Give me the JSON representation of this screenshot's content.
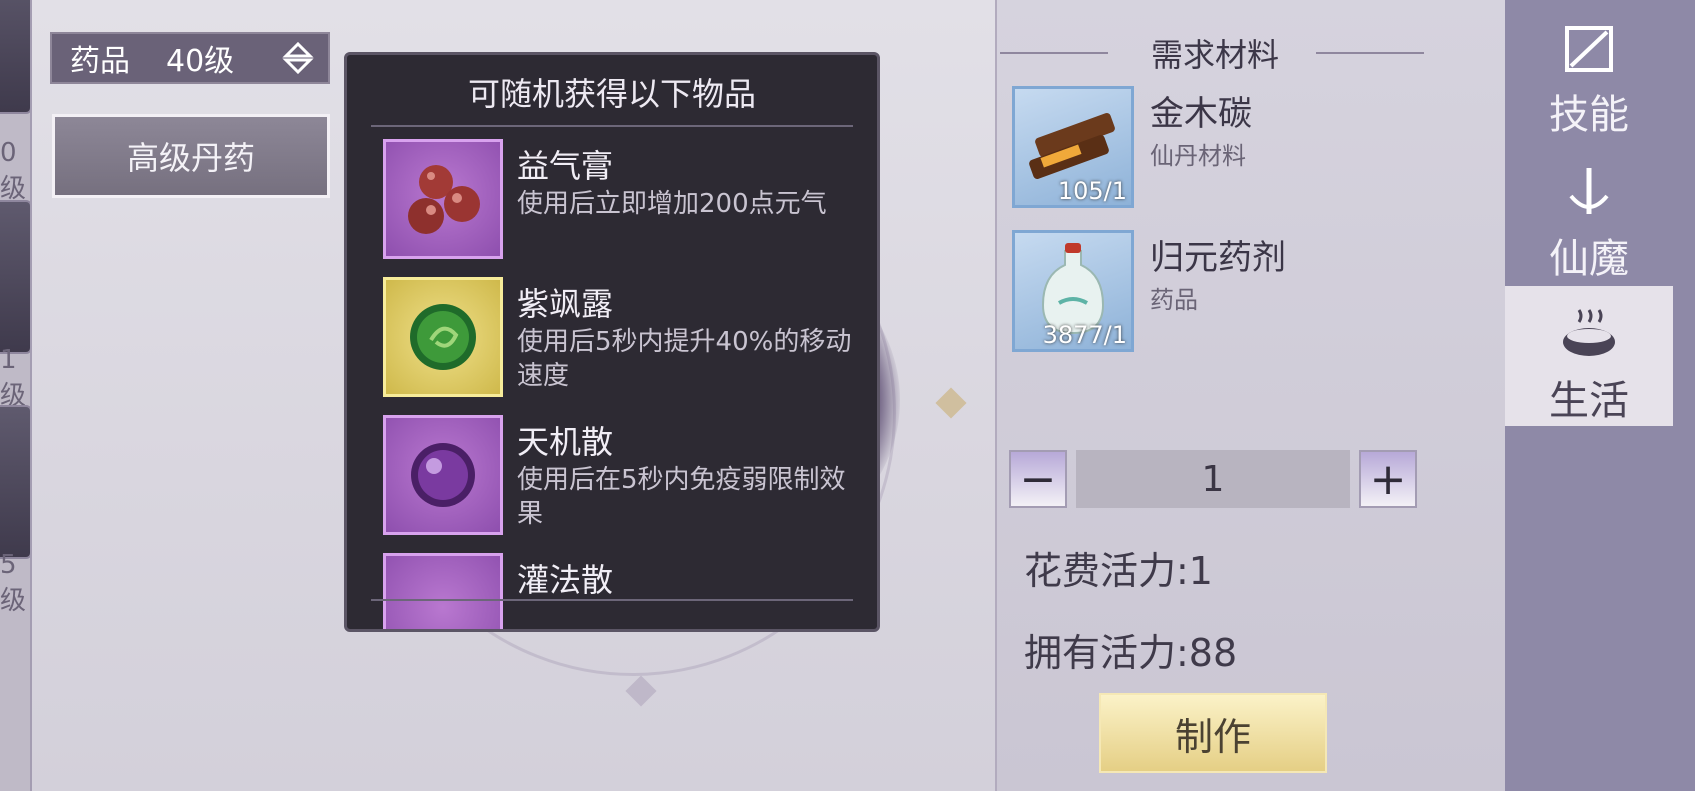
{
  "left_strip": {
    "partial_labels": [
      "0级",
      "1级",
      "5级"
    ]
  },
  "filter": {
    "category": "药品",
    "level": "40级"
  },
  "subtab": {
    "label": "高级丹药"
  },
  "popup": {
    "title": "可随机获得以下物品",
    "items": [
      {
        "name": "益气膏",
        "desc": "使用后立即增加200点元气",
        "icon": "red-pills-icon"
      },
      {
        "name": "紫飒露",
        "desc": "使用后5秒内提升40%的移动速度",
        "icon": "green-orb-icon"
      },
      {
        "name": "天机散",
        "desc": "使用后在5秒内免疫弱限制效果",
        "icon": "purple-orb-icon"
      },
      {
        "name": "灌法散",
        "desc": "",
        "icon": "item-icon"
      }
    ]
  },
  "materials": {
    "title": "需求材料",
    "list": [
      {
        "name": "金木碳",
        "type": "仙丹材料",
        "count": "105/1",
        "icon": "wood-charcoal-icon"
      },
      {
        "name": "归元药剂",
        "type": "药品",
        "count": "3877/1",
        "icon": "potion-bottle-icon"
      }
    ]
  },
  "quantity": {
    "value": "1",
    "minus": "−",
    "plus": "+"
  },
  "cost_text": "花费活力:1",
  "own_text": "拥有活力:88",
  "make_label": "制作",
  "sidebar": [
    {
      "label": "技能",
      "icon": "skill-icon",
      "active": false
    },
    {
      "label": "仙魔",
      "icon": "sword-icon",
      "active": false
    },
    {
      "label": "生活",
      "icon": "cauldron-icon",
      "active": true
    }
  ],
  "colors": {
    "accent_gold": "#e5cf85",
    "sidebar_bg": "#8e89a7",
    "popup_bg": "#2d2a33"
  }
}
